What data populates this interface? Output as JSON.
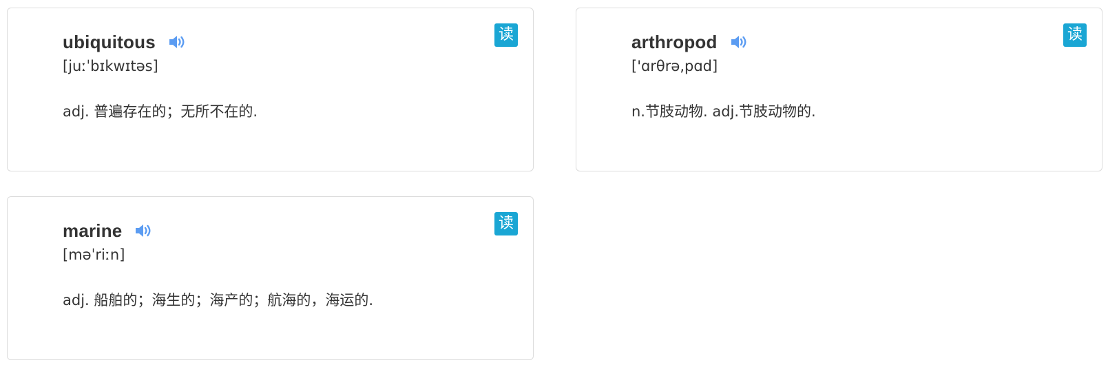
{
  "colors": {
    "read_button_bg": "#1aa6d4",
    "speaker_icon": "#5b9cf2",
    "card_border": "#dcdcdc",
    "text": "#333333"
  },
  "cards": [
    {
      "word": "ubiquitous",
      "phonetic": "[juːˈbɪkwɪtəs]",
      "definition": "adj. 普遍存在的；无所不在的.",
      "read_label": "读",
      "icon": "speaker-icon"
    },
    {
      "word": "arthropod",
      "phonetic": "['ɑrθrə,pɑd]",
      "definition": "n.节肢动物. adj.节肢动物的.",
      "read_label": "读",
      "icon": "speaker-icon"
    },
    {
      "word": "marine",
      "phonetic": "[məˈriːn]",
      "definition": "adj. 船舶的；海生的；海产的；航海的，海运的.",
      "read_label": "读",
      "icon": "speaker-icon"
    }
  ]
}
